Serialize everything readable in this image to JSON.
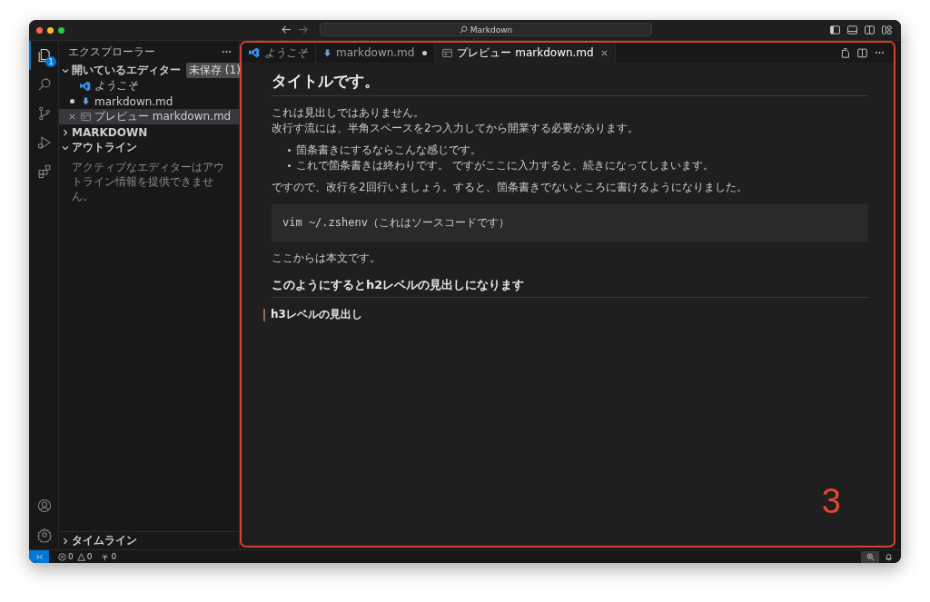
{
  "window": {
    "search": "Markdown"
  },
  "activity_bar": {
    "items": [
      {
        "kind": "files",
        "selected": true,
        "badge": "1"
      },
      {
        "kind": "search",
        "selected": false
      },
      {
        "kind": "source-control",
        "selected": false
      },
      {
        "kind": "run",
        "selected": false
      },
      {
        "kind": "extensions",
        "selected": false
      }
    ],
    "bottom": [
      {
        "kind": "account"
      },
      {
        "kind": "settings"
      }
    ]
  },
  "sidebar": {
    "title": "エクスプローラー",
    "sections": [
      {
        "title": "開いているエディター",
        "expanded": true,
        "badge": "未保存 (1)",
        "items": [
          {
            "kind": "welcome",
            "label": "ようこそ",
            "dirty": false,
            "selected": false
          },
          {
            "kind": "markdown",
            "label": "markdown.md",
            "dirty": true,
            "selected": false
          },
          {
            "kind": "preview",
            "label": "プレビュー markdown.md",
            "dirty": false,
            "selected": true
          }
        ]
      },
      {
        "title": "MARKDOWN",
        "expanded": false
      },
      {
        "title": "アウトライン",
        "expanded": true,
        "message": "アクティブなエディターはアウトライン情報を提供できません。"
      }
    ],
    "footer": {
      "title": "タイムライン",
      "expanded": false
    }
  },
  "tabs": [
    {
      "kind": "welcome",
      "label": "ようこそ",
      "preview": true,
      "dirty": false,
      "selected": false
    },
    {
      "kind": "markdown",
      "label": "markdown.md",
      "preview": false,
      "dirty": true,
      "selected": false
    },
    {
      "kind": "preview",
      "label": "プレビュー markdown.md",
      "preview": false,
      "dirty": false,
      "selected": true
    }
  ],
  "document": [
    {
      "kind": "h1",
      "text": "タイトルです。"
    },
    {
      "kind": "p",
      "lines": [
        "これは見出しではありません。",
        "改行す流には、半角スペースを2つ入力してから開業する必要があります。"
      ]
    },
    {
      "kind": "ul",
      "items": [
        "箇条書きにするならこんな感じです。",
        "これで箇条書きは終わりです。 ですがここに入力すると、続きになってしまいます。"
      ]
    },
    {
      "kind": "p",
      "lines": [
        "ですので、改行を2回行いましょう。すると、箇条書きでないところに書けるようになりました。"
      ]
    },
    {
      "kind": "code",
      "text": "vim ~/.zshenv（これはソースコードです）"
    },
    {
      "kind": "p",
      "lines": [
        "ここからは本文です。"
      ]
    },
    {
      "kind": "h2",
      "text": "このようにするとh2レベルの見出しになります"
    },
    {
      "kind": "h3",
      "text": "h3レベルの見出し"
    }
  ],
  "status_bar": {
    "errors": "0",
    "warnings": "0",
    "ports": "0"
  },
  "annotation": {
    "label": "3"
  }
}
